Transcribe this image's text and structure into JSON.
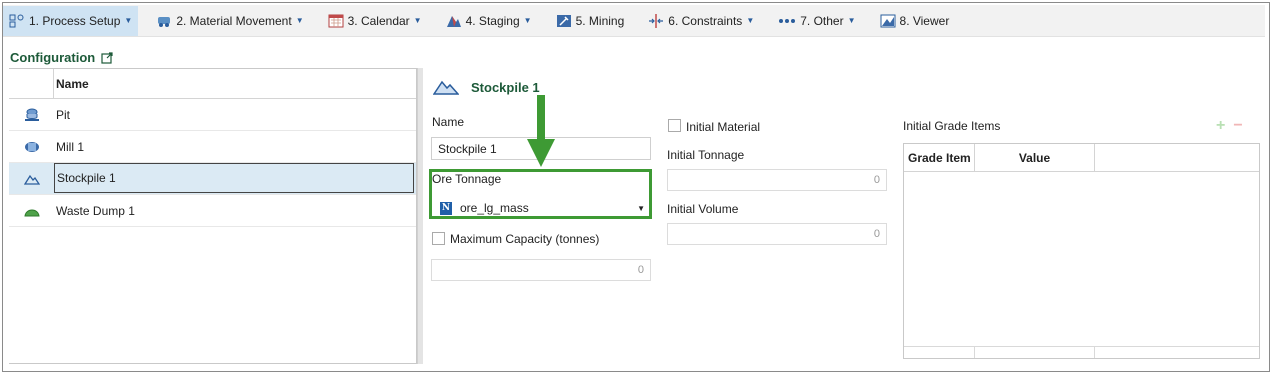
{
  "toolbar": {
    "items": [
      {
        "label": "1. Process Setup",
        "icon": "process-setup-icon"
      },
      {
        "label": "2. Material Movement",
        "icon": "truck-icon"
      },
      {
        "label": "3. Calendar",
        "icon": "calendar-icon"
      },
      {
        "label": "4. Staging",
        "icon": "staging-icon"
      },
      {
        "label": "5. Mining",
        "icon": "mining-icon"
      },
      {
        "label": "6. Constraints",
        "icon": "constraints-icon"
      },
      {
        "label": "7. Other",
        "icon": "ellipsis-icon"
      },
      {
        "label": "8. Viewer",
        "icon": "viewer-icon"
      }
    ],
    "accent": "#cfe3f3"
  },
  "config": {
    "title": "Configuration"
  },
  "list": {
    "header": "Name",
    "rows": [
      {
        "label": "Pit",
        "icon": "pit-icon"
      },
      {
        "label": "Mill 1",
        "icon": "mill-icon"
      },
      {
        "label": "Stockpile 1",
        "icon": "stockpile-icon"
      },
      {
        "label": "Waste Dump 1",
        "icon": "waste-dump-icon"
      }
    ]
  },
  "detail": {
    "title": "Stockpile 1",
    "name_label": "Name",
    "name_value": "Stockpile 1",
    "ore_tonnage_label": "Ore Tonnage",
    "ore_tonnage_value": "ore_lg_mass",
    "max_capacity_label": "Maximum Capacity (tonnes)",
    "max_capacity_value": "0",
    "initial_material_label": "Initial Material",
    "initial_tonnage_label": "Initial Tonnage",
    "initial_tonnage_value": "0",
    "initial_volume_label": "Initial Volume",
    "initial_volume_value": "0",
    "grade_items_label": "Initial Grade Items",
    "grade_columns": [
      "Grade Item",
      "Value"
    ]
  },
  "annotation_color": "#3e9a34"
}
